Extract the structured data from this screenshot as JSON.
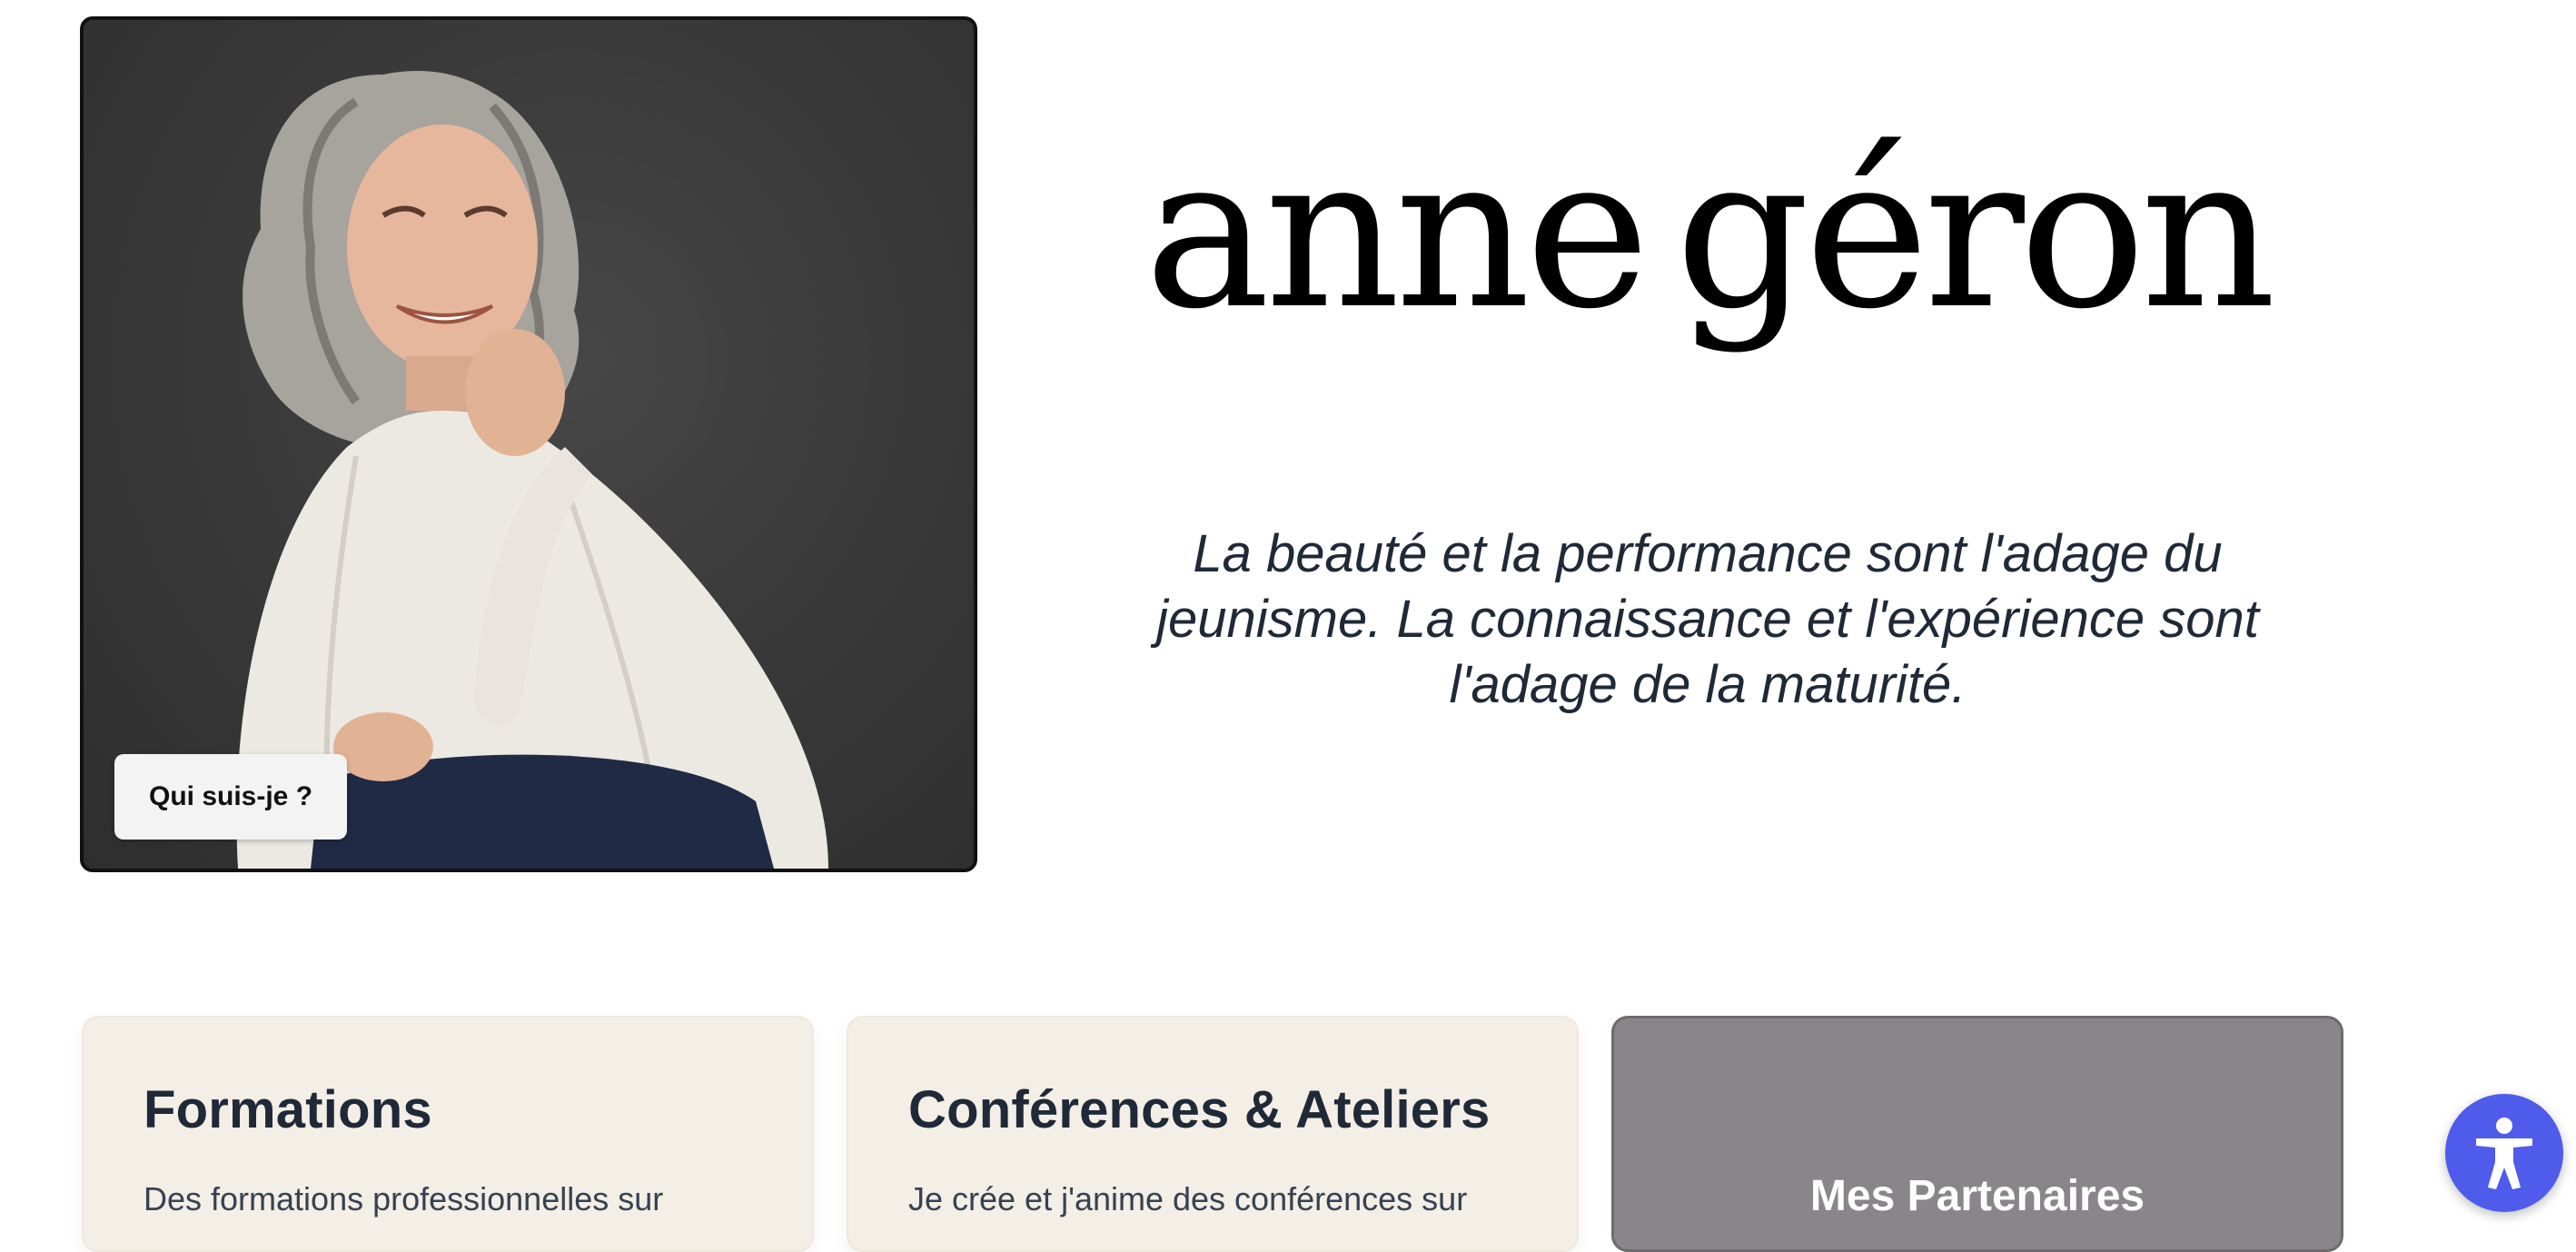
{
  "hero": {
    "photo_button_label": "Qui suis-je ?",
    "logo_word_1": "anne",
    "logo_word_2": "géron",
    "quote": "La beauté et la performance sont l'adage du jeunisme. La connaissance et l'expérience sont l'adage de la maturité."
  },
  "cards": [
    {
      "title": "Formations",
      "text": "Des formations professionnelles sur"
    },
    {
      "title": "Conférences & Ateliers",
      "text": "Je crée et j'anime des conférences sur"
    },
    {
      "title": "Mes Partenaires"
    }
  ],
  "accessibility": {
    "icon": "accessibility-icon"
  },
  "colors": {
    "card_beige": "#f3eee6",
    "card_gray": "#8a8589",
    "accessibility_button": "#4f5bea",
    "text_dark": "#1f2937"
  }
}
